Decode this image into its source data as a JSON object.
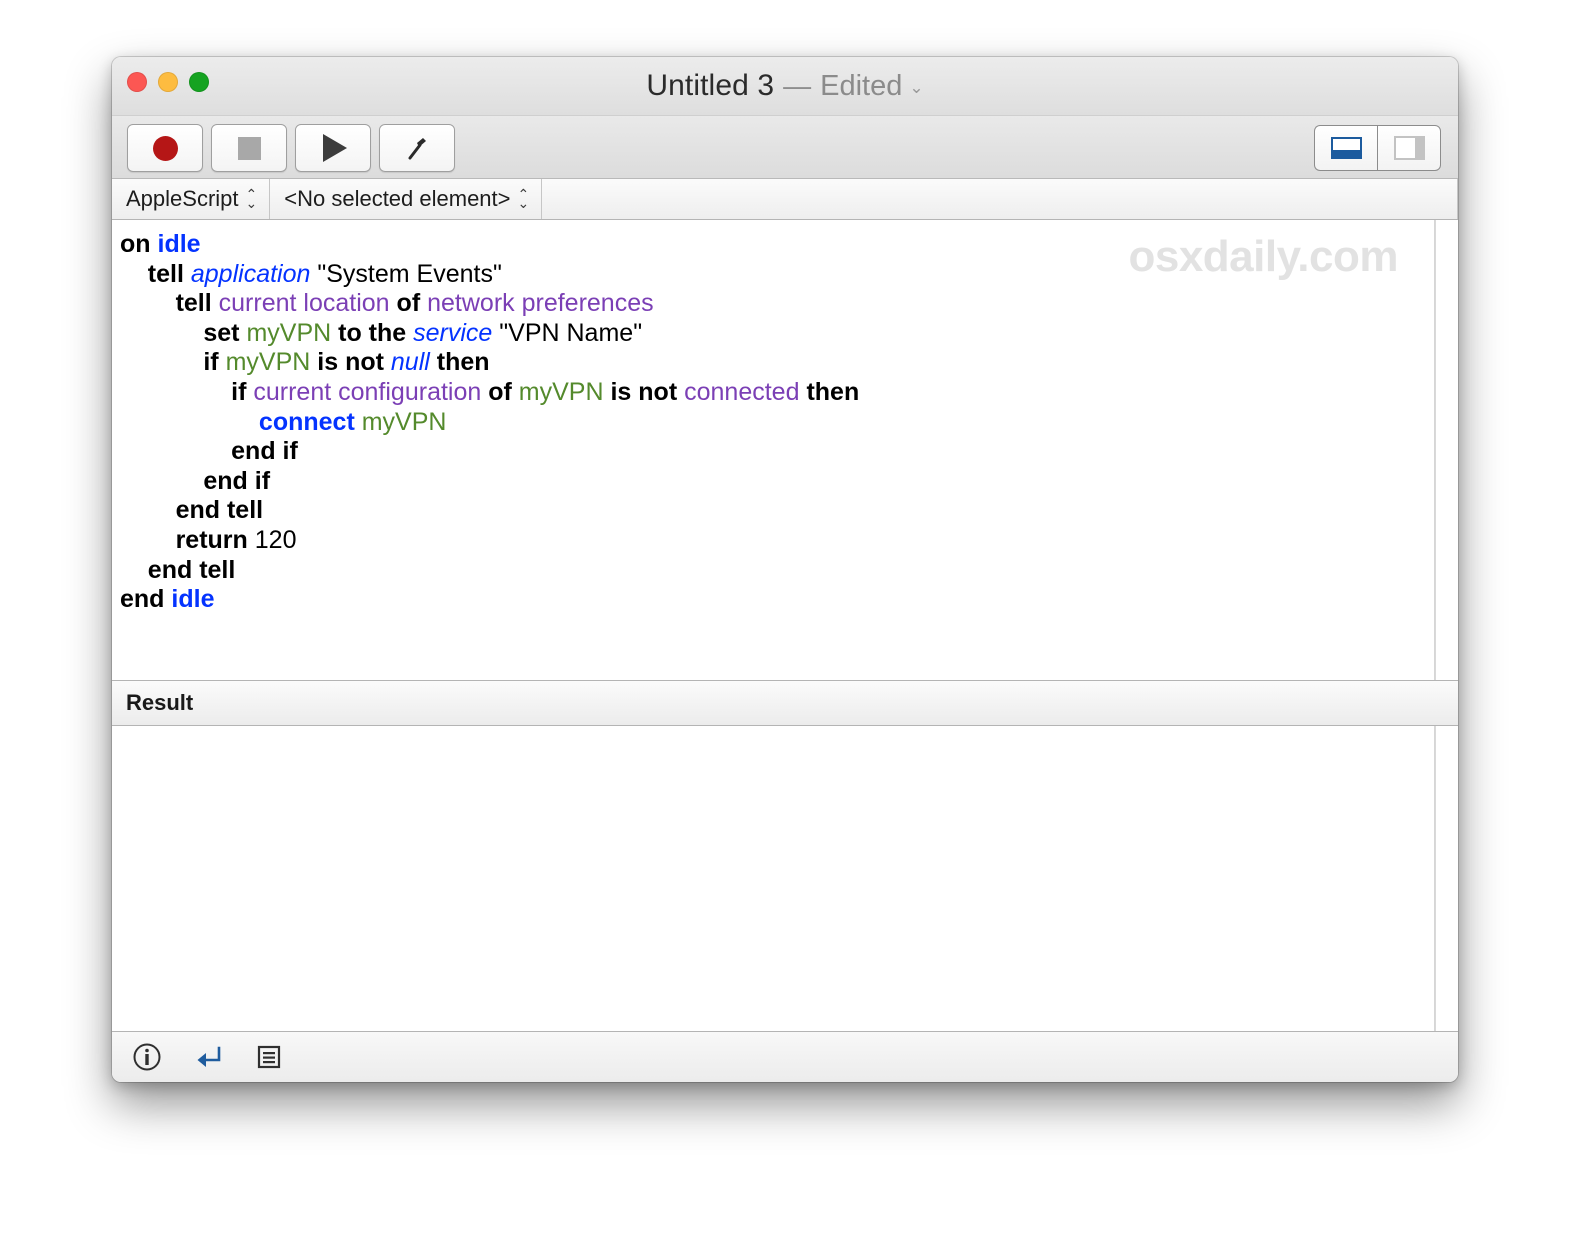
{
  "window": {
    "title": "Untitled 3",
    "dash": "—",
    "edited_label": "Edited",
    "chevron": "⌄",
    "traffic_lights": {
      "close": "close-button",
      "minimize": "minimize-button",
      "zoom": "zoom-button"
    },
    "colors": {
      "close": "#fc5753",
      "minimize": "#fdbc40",
      "zoom": "#15a321",
      "accent_blue": "#1c5b9e",
      "record_red": "#b51616",
      "keyword_blue": "#0433ff",
      "property_purple": "#7b3fb5",
      "variable_green": "#548a2c"
    }
  },
  "toolbar": {
    "record_label": "Record",
    "stop_label": "Stop",
    "run_label": "Run",
    "compile_label": "Compile",
    "view_bottom_label": "Show bottom panel",
    "view_right_label": "Show right panel"
  },
  "popup_bar": {
    "language": "AppleScript",
    "element": "<No selected element>",
    "chevron_up": "⌃",
    "chevron_down": "⌄"
  },
  "editor": {
    "watermark": "osxdaily.com",
    "lines": [
      {
        "indent": 0,
        "tokens": [
          {
            "t": "on",
            "c": "kw"
          },
          {
            "t": " ",
            "c": "plain"
          },
          {
            "t": "idle",
            "c": "han"
          }
        ]
      },
      {
        "indent": 1,
        "tokens": [
          {
            "t": "tell",
            "c": "kw"
          },
          {
            "t": " ",
            "c": "plain"
          },
          {
            "t": "application",
            "c": "ref"
          },
          {
            "t": " ",
            "c": "plain"
          },
          {
            "t": "\"System Events\"",
            "c": "str"
          }
        ]
      },
      {
        "indent": 2,
        "tokens": [
          {
            "t": "tell",
            "c": "kw"
          },
          {
            "t": " ",
            "c": "plain"
          },
          {
            "t": "current location",
            "c": "prop"
          },
          {
            "t": " ",
            "c": "plain"
          },
          {
            "t": "of",
            "c": "kw"
          },
          {
            "t": " ",
            "c": "plain"
          },
          {
            "t": "network preferences",
            "c": "prop"
          }
        ]
      },
      {
        "indent": 3,
        "tokens": [
          {
            "t": "set",
            "c": "kw"
          },
          {
            "t": " ",
            "c": "plain"
          },
          {
            "t": "myVPN",
            "c": "var"
          },
          {
            "t": " ",
            "c": "plain"
          },
          {
            "t": "to the",
            "c": "kw"
          },
          {
            "t": " ",
            "c": "plain"
          },
          {
            "t": "service",
            "c": "ref"
          },
          {
            "t": " ",
            "c": "plain"
          },
          {
            "t": "\"VPN Name\"",
            "c": "str"
          }
        ]
      },
      {
        "indent": 3,
        "tokens": [
          {
            "t": "if",
            "c": "kw"
          },
          {
            "t": " ",
            "c": "plain"
          },
          {
            "t": "myVPN",
            "c": "var"
          },
          {
            "t": " ",
            "c": "plain"
          },
          {
            "t": "is not",
            "c": "kw"
          },
          {
            "t": " ",
            "c": "plain"
          },
          {
            "t": "null",
            "c": "ref"
          },
          {
            "t": " ",
            "c": "plain"
          },
          {
            "t": "then",
            "c": "kw"
          }
        ]
      },
      {
        "indent": 4,
        "tokens": [
          {
            "t": "if",
            "c": "kw"
          },
          {
            "t": " ",
            "c": "plain"
          },
          {
            "t": "current configuration",
            "c": "prop"
          },
          {
            "t": " ",
            "c": "plain"
          },
          {
            "t": "of",
            "c": "kw"
          },
          {
            "t": " ",
            "c": "plain"
          },
          {
            "t": "myVPN",
            "c": "var"
          },
          {
            "t": " ",
            "c": "plain"
          },
          {
            "t": "is not",
            "c": "kw"
          },
          {
            "t": " ",
            "c": "plain"
          },
          {
            "t": "connected",
            "c": "prop"
          },
          {
            "t": " ",
            "c": "plain"
          },
          {
            "t": "then",
            "c": "kw"
          }
        ]
      },
      {
        "indent": 5,
        "tokens": [
          {
            "t": "connect",
            "c": "cmd"
          },
          {
            "t": " ",
            "c": "plain"
          },
          {
            "t": "myVPN",
            "c": "var"
          }
        ]
      },
      {
        "indent": 4,
        "tokens": [
          {
            "t": "end if",
            "c": "kw"
          }
        ]
      },
      {
        "indent": 3,
        "tokens": [
          {
            "t": "end if",
            "c": "kw"
          }
        ]
      },
      {
        "indent": 2,
        "tokens": [
          {
            "t": "end tell",
            "c": "kw"
          }
        ]
      },
      {
        "indent": 2,
        "tokens": [
          {
            "t": "return",
            "c": "kw"
          },
          {
            "t": " ",
            "c": "plain"
          },
          {
            "t": "120",
            "c": "num"
          }
        ]
      },
      {
        "indent": 1,
        "tokens": [
          {
            "t": "end tell",
            "c": "kw"
          }
        ]
      },
      {
        "indent": 0,
        "tokens": [
          {
            "t": "end",
            "c": "kw"
          },
          {
            "t": " ",
            "c": "plain"
          },
          {
            "t": "idle",
            "c": "han"
          }
        ]
      }
    ]
  },
  "result": {
    "header": "Result",
    "content": ""
  },
  "statusbar": {
    "info_label": "Description",
    "result_label": "Result",
    "log_label": "Event Log"
  }
}
